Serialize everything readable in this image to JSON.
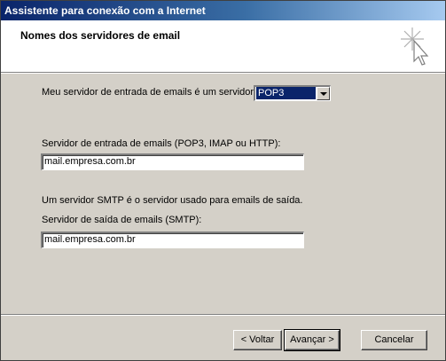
{
  "window": {
    "title": "Assistente para conexão com a Internet"
  },
  "header": {
    "title": "Nomes dos servidores de email",
    "icon": "wizard-sparkle-cursor-icon"
  },
  "form": {
    "server_type_label": "Meu servidor de entrada de emails é um  servidor",
    "server_type_value": "POP3",
    "incoming_label": "Servidor de entrada de emails (POP3, IMAP ou HTTP):",
    "incoming_value": "mail.empresa.com.br",
    "smtp_note": "Um servidor SMTP é o servidor usado para emails de saída.",
    "outgoing_label": "Servidor de saída de emails (SMTP):",
    "outgoing_value": "mail.empresa.com.br"
  },
  "buttons": {
    "back": "< Voltar",
    "next": "Avançar >",
    "cancel": "Cancelar"
  }
}
